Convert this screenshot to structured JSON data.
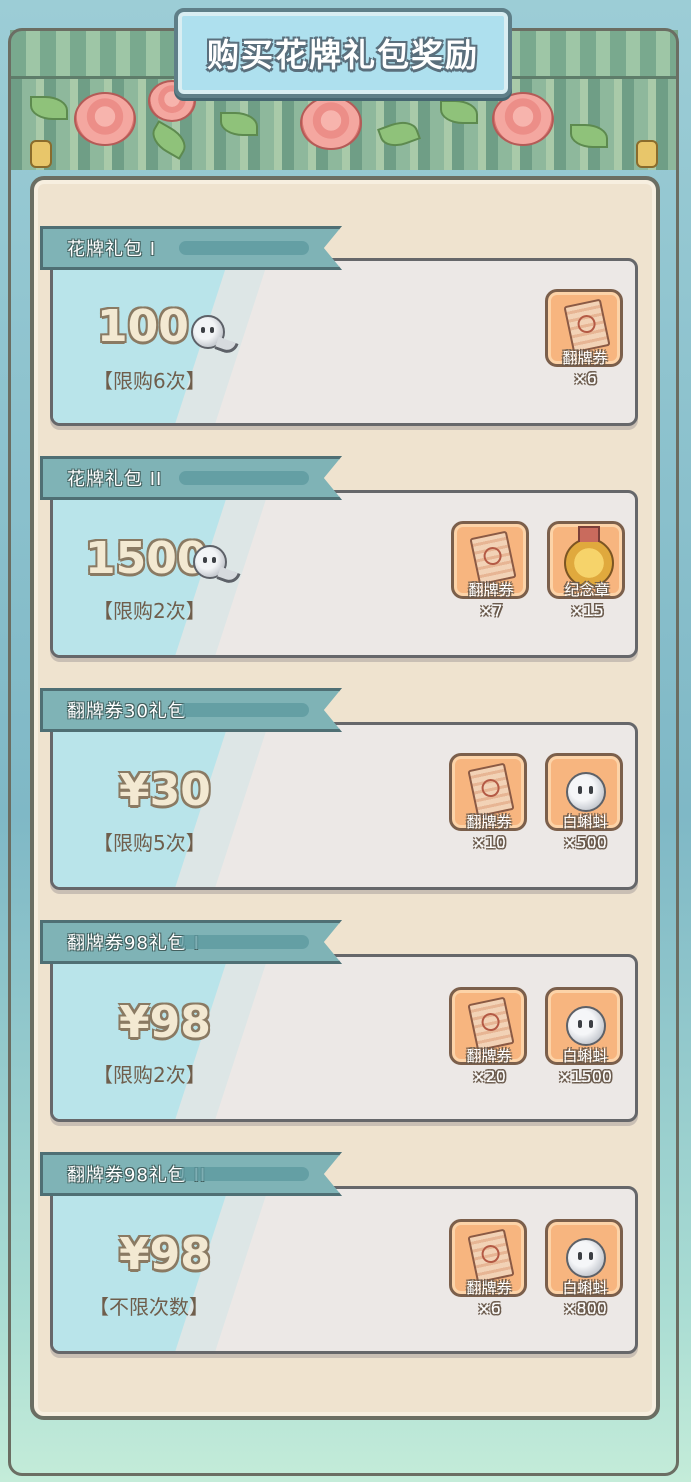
{
  "header": {
    "title": "购买花牌礼包奖励"
  },
  "colors": {
    "accent_ribbon": "#7fb3b6",
    "reward_tile": "#f7b57f",
    "panel": "#efe3cf"
  },
  "packs": [
    {
      "name": "花牌礼包 I",
      "price": "100",
      "currency_icon": "tadpole-icon",
      "limit": "【限购6次】",
      "rewards": [
        {
          "icon": "ticket-icon",
          "name": "翻牌券",
          "qty": "×6"
        }
      ]
    },
    {
      "name": "花牌礼包 II",
      "price": "1500",
      "currency_icon": "tadpole-icon",
      "limit": "【限购2次】",
      "rewards": [
        {
          "icon": "ticket-icon",
          "name": "翻牌券",
          "qty": "×7"
        },
        {
          "icon": "medal-icon",
          "name": "纪念章",
          "qty": "×15"
        }
      ]
    },
    {
      "name": "翻牌券30礼包",
      "price": "¥30",
      "limit": "【限购5次】",
      "rewards": [
        {
          "icon": "ticket-icon",
          "name": "翻牌券",
          "qty": "×10"
        },
        {
          "icon": "tadpole-icon",
          "name": "白蝌蚪",
          "qty": "×500"
        }
      ]
    },
    {
      "name": "翻牌券98礼包 I",
      "price": "¥98",
      "limit": "【限购2次】",
      "rewards": [
        {
          "icon": "ticket-icon",
          "name": "翻牌券",
          "qty": "×20"
        },
        {
          "icon": "tadpole-icon",
          "name": "白蝌蚪",
          "qty": "×1500"
        }
      ]
    },
    {
      "name": "翻牌券98礼包 II",
      "price": "¥98",
      "limit": "【不限次数】",
      "rewards": [
        {
          "icon": "ticket-icon",
          "name": "翻牌券",
          "qty": "×6"
        },
        {
          "icon": "tadpole-icon",
          "name": "白蝌蚪",
          "qty": "×800"
        }
      ]
    }
  ]
}
